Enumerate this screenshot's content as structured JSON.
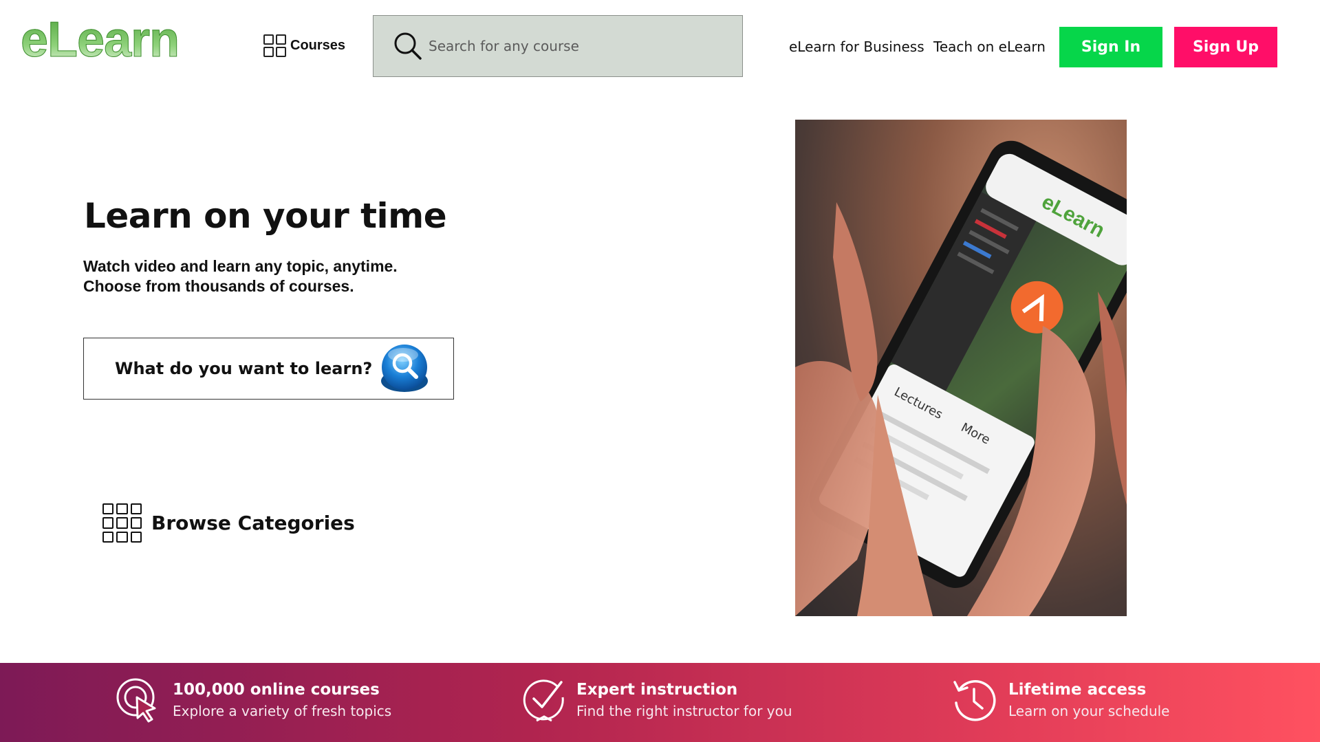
{
  "header": {
    "logo_text": "eLearn",
    "courses_label": "Courses",
    "search_placeholder": "Search for any course",
    "business_link": "eLearn for Business",
    "teach_link": "Teach on eLearn",
    "signin_label": "Sign In",
    "signup_label": "Sign Up",
    "colors": {
      "signin": "#06d64a",
      "signup": "#ff0e68",
      "search_bg": "#d3dad3"
    }
  },
  "hero": {
    "title": "Learn on your time",
    "subtitle_line1": "Watch video and learn any topic, anytime.",
    "subtitle_line2": "Choose from thousands of courses.",
    "cta_label": "What do you want to learn?",
    "cta_icon": "search-orb-icon",
    "browse_label": "Browse Categories",
    "browse_icon": "grid-icon"
  },
  "photo": {
    "alt": "Hands holding a phone showing the eLearn app",
    "app_logo": "eLearn",
    "tabs": [
      "Lectures",
      "More"
    ]
  },
  "features": [
    {
      "icon": "cursor-click-icon",
      "title": "100,000 online courses",
      "subtitle": "Explore a variety of fresh topics"
    },
    {
      "icon": "checkmark-badge-icon",
      "title": "Expert instruction",
      "subtitle": "Find the right instructor for you"
    },
    {
      "icon": "clock-history-icon",
      "title": "Lifetime access",
      "subtitle": "Learn on your schedule"
    }
  ]
}
